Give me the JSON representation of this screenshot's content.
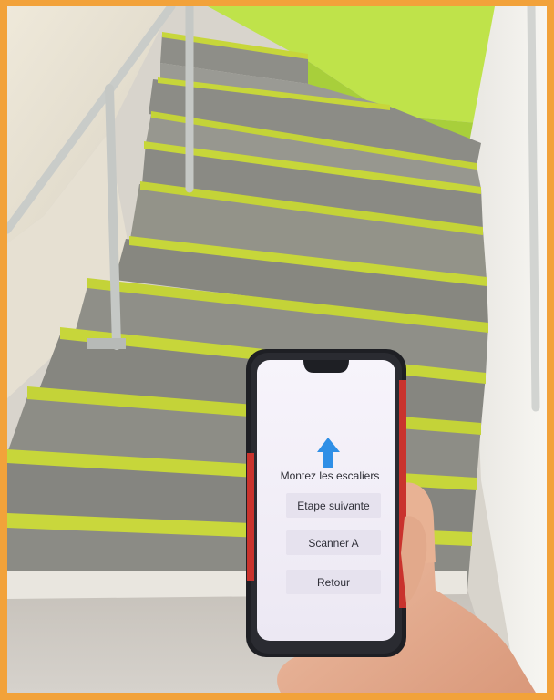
{
  "photo": {
    "frame_color": "#f2a23a",
    "stair_nosing_color": "#c7d63a",
    "wall_accent_color": "#b8e045"
  },
  "app": {
    "instruction": "Montez les escaliers",
    "arrow_icon": "arrow-up-icon",
    "arrow_color": "#2f8fe6",
    "buttons": [
      {
        "label": "Etape suivante"
      },
      {
        "label": "Scanner A"
      },
      {
        "label": "Retour"
      }
    ]
  }
}
